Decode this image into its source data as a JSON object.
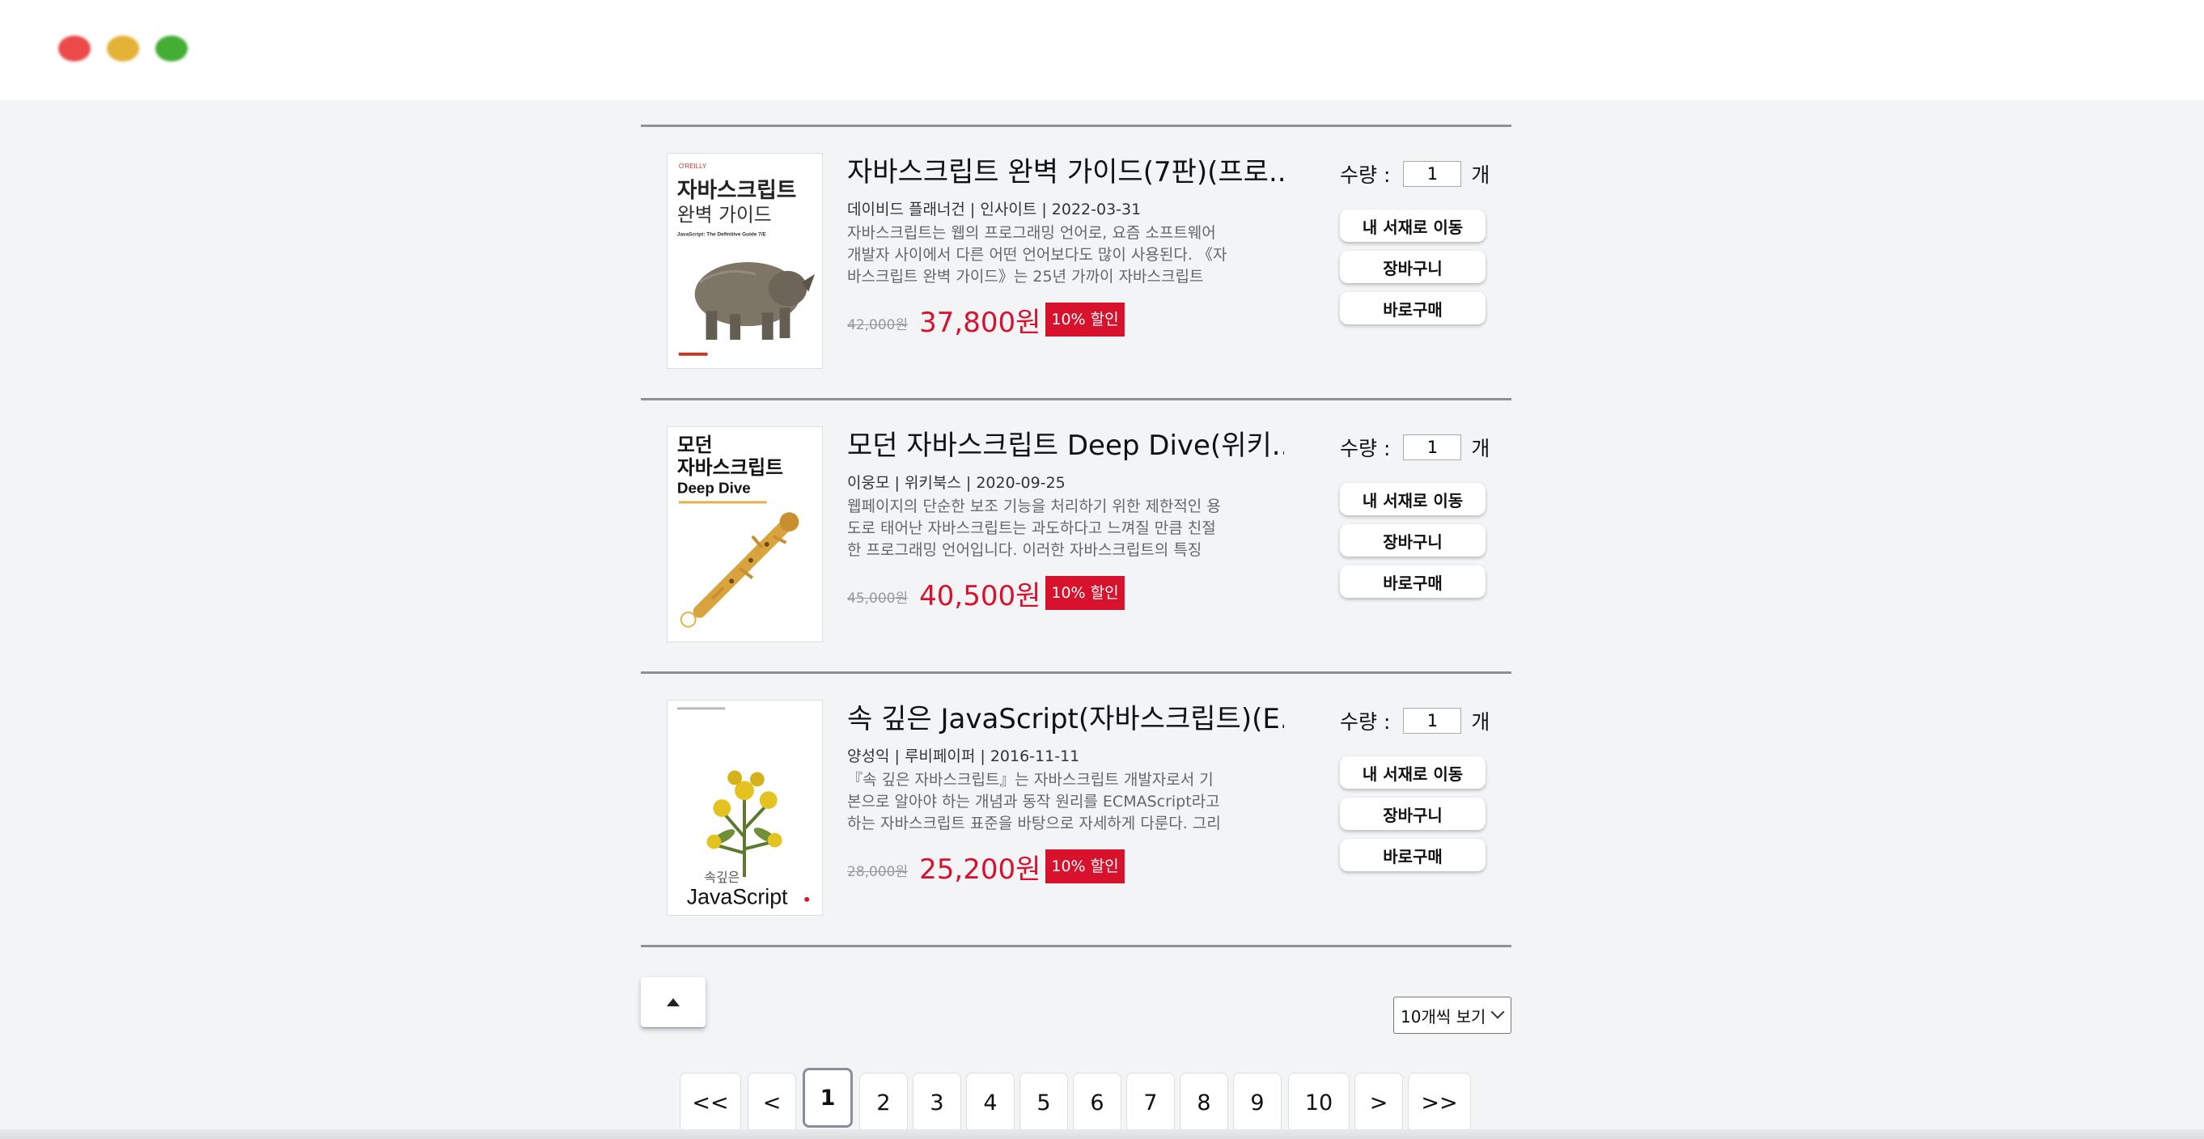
{
  "window": {
    "controls": [
      "close",
      "minimize",
      "maximize"
    ]
  },
  "books": [
    {
      "title": "자바스크립트 완벽 가이드(7판)(프로...",
      "author": "데이비드 플래너건",
      "publisher": "인사이트",
      "date": "2022-03-31",
      "desc": "자바스크립트는 웹의 프로그래밍 언어로, 요즘 소프트웨어 개발자 사이에서 다른 어떤 언어보다도 많이 사용된다. 《자바스크립트 완벽 가이드》는 25년 가까이 자바스크립트 프...",
      "original_price": "42,000원",
      "price": "37,800원",
      "badge": "10% 할인",
      "quantity": "1",
      "cover_image": "rhino-cover",
      "cover_text": {
        "publisher": "O'REILLY",
        "title1": "자바스크립트",
        "title2": "완벽 가이드",
        "subtitle": "JavaScript: The Definitive Guide 7/E"
      }
    },
    {
      "title": "모던 자바스크립트 Deep Dive(위키...",
      "author": "이웅모",
      "publisher": "위키북스",
      "date": "2020-09-25",
      "desc": "웹페이지의 단순한 보조 기능을 처리하기 위한 제한적인 용도로 태어난 자바스크립트는 과도하다고 느껴질 만큼 친절한 프로그래밍 언어입니다. 이러한 자바스크립트의 특징은...",
      "original_price": "45,000원",
      "price": "40,500원",
      "badge": "10% 할인",
      "quantity": "1",
      "cover_image": "gecko-cover",
      "cover_text": {
        "title1": "모던",
        "title2": "자바스크립트",
        "title3": "Deep Dive"
      }
    },
    {
      "title": "속 깊은 JavaScript(자바스크립트)(E...",
      "author": "양성익",
      "publisher": "루비페이퍼",
      "date": "2016-11-11",
      "desc": "『속 깊은 자바스크립트』는 자바스크립트 개발자로서 기본으로 알아야 하는 개념과 동작 원리를 ECMAScript라고 하는 자바스크립트 표준을 바탕으로 자세하게 다룬다. 그리고 ...",
      "original_price": "28,000원",
      "price": "25,200원",
      "badge": "10% 할인",
      "quantity": "1",
      "cover_image": "flower-cover",
      "cover_text": {
        "title1": "속깊은",
        "title2": "JavaScript"
      }
    }
  ],
  "labels": {
    "qty_label": "수량 :",
    "qty_unit": "개",
    "move_shelf": "내 서재로 이동",
    "cart": "장바구니",
    "buy_now": "바로구매"
  },
  "per_page": "10개씩 보기",
  "pagination": {
    "first": "<<",
    "prev": "<",
    "pages": [
      "1",
      "2",
      "3",
      "4",
      "5",
      "6",
      "7",
      "8",
      "9",
      "10"
    ],
    "current": "1",
    "next": ">",
    "last": ">>"
  },
  "colors": {
    "accent": "#d8112c",
    "background": "#f3f4f6"
  },
  "icons": {
    "scroll_top": "triangle-up-icon",
    "dropdown": "chevron-down-icon"
  }
}
